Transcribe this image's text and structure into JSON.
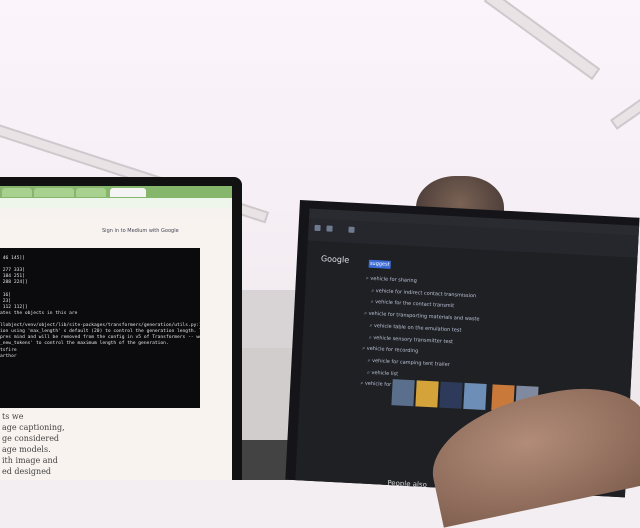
{
  "scene": {
    "description_free": true
  },
  "left_laptop": {
    "popup_text": "Sign in to Medium with Google",
    "terminal_lines": [
      "",
      " 46 145]]",
      "",
      " 277 333]",
      " 184 251]",
      " 288 224]]",
      "",
      " 16]",
      " 23]",
      " 112 112]]",
      "ates the objects in this are",
      "",
      "llobject/venv/object/lib/site-packages/transformers/generation/utils.py:131",
      "ion using 'max_length' s default (20) to control the generation length. This beha",
      "pres mind and will be removed from the config in v5 of Transformers -- we recommend",
      "_new_tokens' to control the maximum length of the generation.",
      "tsfire",
      "arthor"
    ],
    "doc_lines": [
      "ts we",
      "age captioning,",
      "ge considered",
      "age models.",
      "ith image and",
      "ed designed"
    ]
  },
  "right_laptop": {
    "logo": "Google",
    "query_chip": "suggest",
    "suggestions": [
      "vehicle for sharing",
      "vehicle for indirect contact transmission",
      "vehicle for the contact transmit",
      "vehicle for transporting materials and waste",
      "vehicle table on the emulation test",
      "vehicle sensory transmitter test",
      "vehicle for recording",
      "vehicle for camping tent trailer",
      "vehicle list",
      "vehicle for trips"
    ],
    "footer_text": "People also"
  }
}
